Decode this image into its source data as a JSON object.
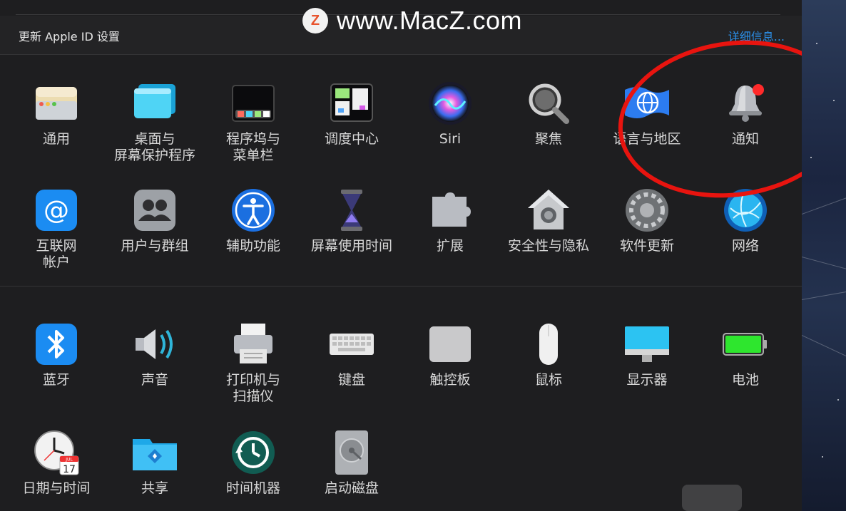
{
  "watermark": {
    "logo_letter": "Z",
    "text": "www.MacZ.com"
  },
  "banner": {
    "title": "更新 Apple ID 设置",
    "link": "详细信息..."
  },
  "panes": [
    {
      "key": "general",
      "label": "通用",
      "icon": "general-icon"
    },
    {
      "key": "desktop",
      "label": "桌面与\n屏幕保护程序",
      "icon": "desktop-screensaver-icon"
    },
    {
      "key": "dock",
      "label": "程序坞与\n菜单栏",
      "icon": "dock-menubar-icon"
    },
    {
      "key": "mission",
      "label": "调度中心",
      "icon": "mission-control-icon"
    },
    {
      "key": "siri",
      "label": "Siri",
      "icon": "siri-icon"
    },
    {
      "key": "spotlight",
      "label": "聚焦",
      "icon": "spotlight-icon"
    },
    {
      "key": "language",
      "label": "语言与地区",
      "icon": "language-region-icon"
    },
    {
      "key": "notifications",
      "label": "通知",
      "icon": "notifications-icon"
    },
    {
      "key": "internet",
      "label": "互联网\n帐户",
      "icon": "internet-accounts-icon"
    },
    {
      "key": "users",
      "label": "用户与群组",
      "icon": "users-groups-icon"
    },
    {
      "key": "accessibility",
      "label": "辅助功能",
      "icon": "accessibility-icon"
    },
    {
      "key": "screentime",
      "label": "屏幕使用时间",
      "icon": "screen-time-icon"
    },
    {
      "key": "extensions",
      "label": "扩展",
      "icon": "extensions-icon"
    },
    {
      "key": "security",
      "label": "安全性与隐私",
      "icon": "security-privacy-icon"
    },
    {
      "key": "update",
      "label": "软件更新",
      "icon": "software-update-icon"
    },
    {
      "key": "network",
      "label": "网络",
      "icon": "network-icon"
    },
    {
      "key": "bluetooth",
      "label": "蓝牙",
      "icon": "bluetooth-icon"
    },
    {
      "key": "sound",
      "label": "声音",
      "icon": "sound-icon"
    },
    {
      "key": "printers",
      "label": "打印机与\n扫描仪",
      "icon": "printers-scanners-icon"
    },
    {
      "key": "keyboard",
      "label": "键盘",
      "icon": "keyboard-icon"
    },
    {
      "key": "trackpad",
      "label": "触控板",
      "icon": "trackpad-icon"
    },
    {
      "key": "mouse",
      "label": "鼠标",
      "icon": "mouse-icon"
    },
    {
      "key": "displays",
      "label": "显示器",
      "icon": "displays-icon"
    },
    {
      "key": "battery",
      "label": "电池",
      "icon": "battery-icon"
    },
    {
      "key": "datetime",
      "label": "日期与时间",
      "icon": "date-time-icon"
    },
    {
      "key": "sharing",
      "label": "共享",
      "icon": "sharing-icon"
    },
    {
      "key": "timemachine",
      "label": "时间机器",
      "icon": "time-machine-icon"
    },
    {
      "key": "startup",
      "label": "启动磁盘",
      "icon": "startup-disk-icon"
    }
  ],
  "calendar_icon": {
    "month": "JUL",
    "day": "17"
  },
  "colors": {
    "accent": "#2b8fe8",
    "highlight_circle": "#e8140f",
    "background": "#1e1e20"
  }
}
